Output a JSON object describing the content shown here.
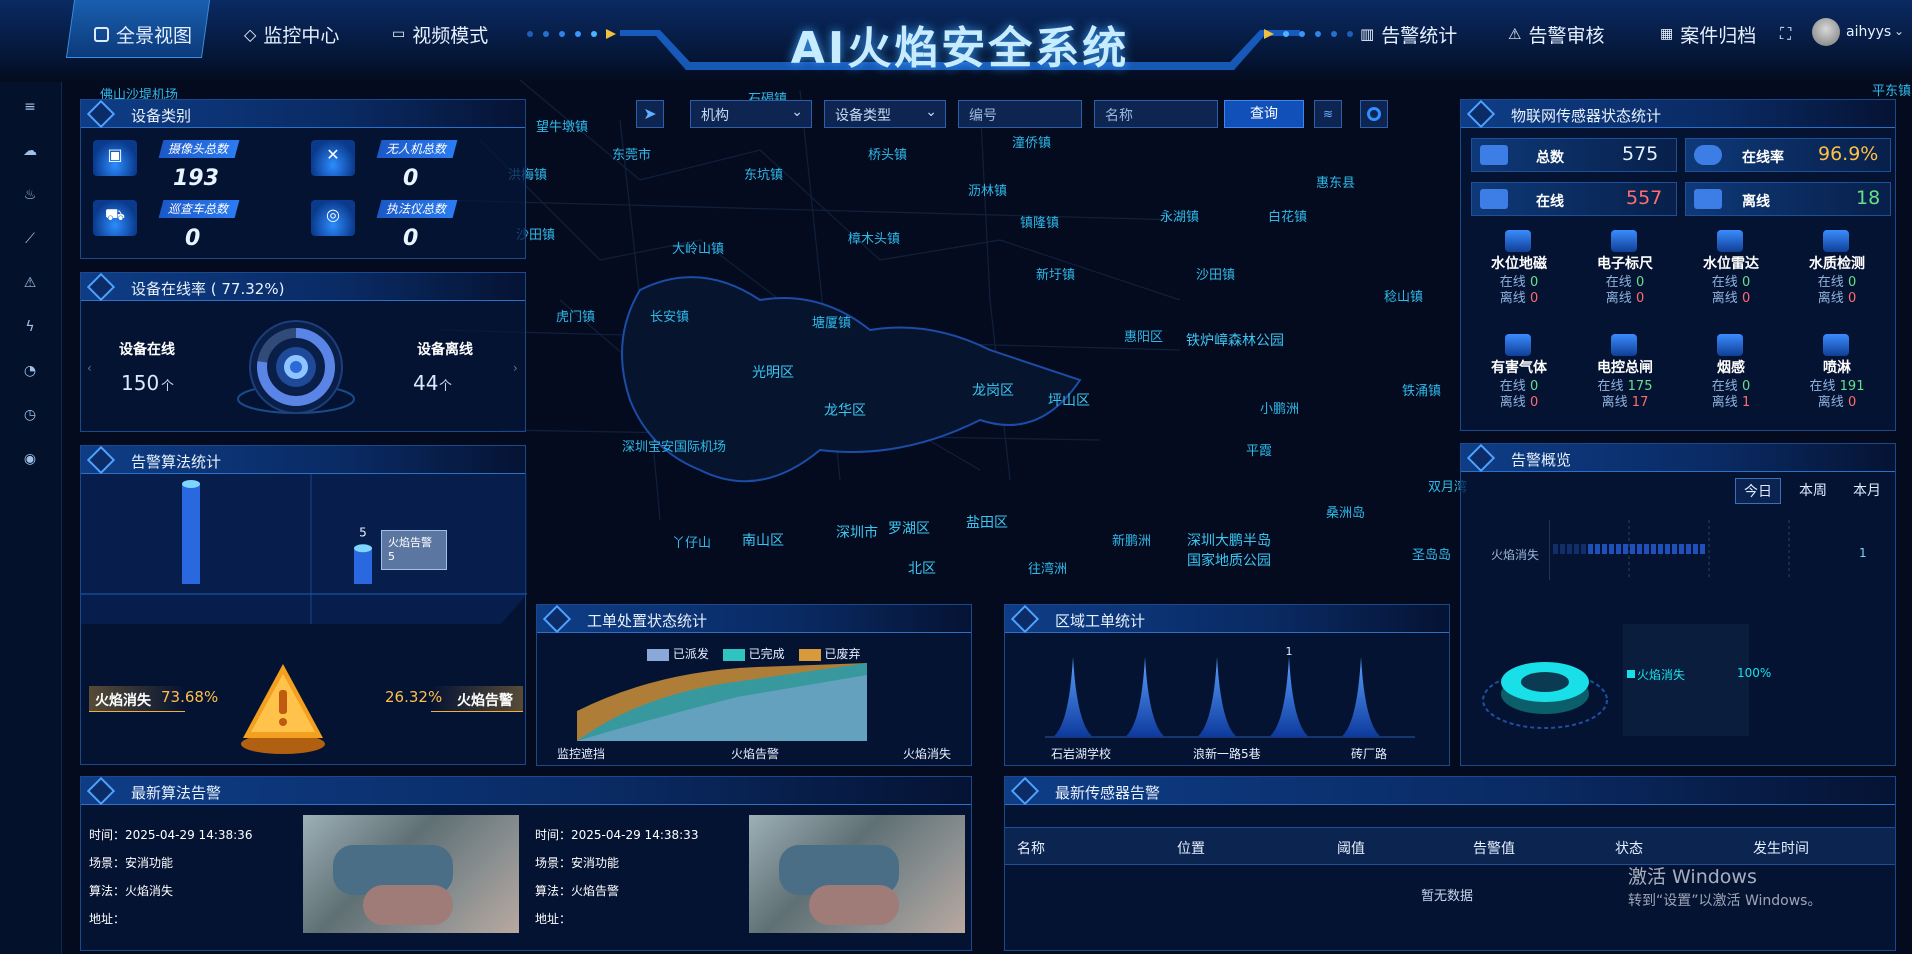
{
  "header": {
    "title": "AI火焰安全系统",
    "tabs_left": [
      "全景视图",
      "监控中心",
      "视频模式"
    ],
    "tabs_right": [
      "告警统计",
      "告警审核",
      "案件归档"
    ],
    "user": "aihyys"
  },
  "map_labels": [
    "佛山沙堤机场",
    "望牛墩镇",
    "东莞市",
    "桥头镇",
    "潼侨镇",
    "惠东县",
    "洪梅镇",
    "东坑镇",
    "沥林镇",
    "沙田镇",
    "樟木头镇",
    "镇隆镇",
    "永湖镇",
    "白花镇",
    "大岭山镇",
    "新圩镇",
    "沙田镇",
    "稔山镇",
    "虎门镇",
    "长安镇",
    "塘厦镇",
    "惠阳区",
    "铁炉嶂森林公园",
    "光明区",
    "龙岗区",
    "坪山区",
    "小鹏洲",
    "铁涌镇",
    "龙华区",
    "深圳宝安国际机场",
    "平霞",
    "桑洲岛",
    "双月湾",
    "南山区",
    "深圳市",
    "罗湖区",
    "盐田区",
    "新鹏洲",
    "深圳大鹏半岛国家地质公园",
    "圣岛岛",
    "丫仔山",
    "往湾洲",
    "北区",
    "石碣镇",
    "平东镇"
  ],
  "toolbar": {
    "org": "机构",
    "device_type": "设备类型",
    "number_placeholder": "编号",
    "name_placeholder": "名称",
    "query": "查询"
  },
  "device_category": {
    "title": "设备类别",
    "items": [
      {
        "label": "摄像头总数",
        "value": "193",
        "icon": "camera-icon"
      },
      {
        "label": "无人机总数",
        "value": "0",
        "icon": "drone-icon"
      },
      {
        "label": "巡查车总数",
        "value": "0",
        "icon": "car-icon"
      },
      {
        "label": "执法仪总数",
        "value": "0",
        "icon": "recorder-icon"
      }
    ]
  },
  "online_rate": {
    "title": "设备在线率 ( 77.32%)",
    "online_label": "设备在线",
    "online_value": "150",
    "offline_label": "设备离线",
    "offline_value": "44",
    "unit": "个",
    "rate": 77.32
  },
  "algo_stats": {
    "title": "告警算法统计",
    "bars": [
      {
        "name": "火焰消失",
        "value": 14
      },
      {
        "name": "火焰告警",
        "value": 5
      }
    ],
    "tooltip_name": "火焰告警",
    "tooltip_value": "5",
    "ratio_left_label": "火焰消失",
    "ratio_left_value": "73.68%",
    "ratio_right_label": "火焰告警",
    "ratio_right_value": "26.32%"
  },
  "workorder_status": {
    "title": "工单处置状态统计",
    "legend": [
      "已派发",
      "已完成",
      "已废弃"
    ],
    "x_labels": [
      "监控遮挡",
      "火焰告警",
      "火焰消失"
    ],
    "colors": [
      "#8aa8d8",
      "#2fc4c0",
      "#d89a3a"
    ]
  },
  "region_workorder": {
    "title": "区域工单统计",
    "peaks": [
      0,
      0,
      0,
      1,
      0
    ],
    "peak_label": "1",
    "x_labels": [
      "石岩湖学校",
      "浪新一路5巷",
      "砖厂路"
    ]
  },
  "iot_stats": {
    "title": "物联网传感器状态统计",
    "total_label": "总数",
    "total_value": "575",
    "rate_label": "在线率",
    "rate_value": "96.9%",
    "online_label": "在线",
    "online_value": "557",
    "offline_label": "离线",
    "offline_value": "18",
    "sensors": [
      {
        "name": "水位地磁",
        "online": "0",
        "offline": "0"
      },
      {
        "name": "电子标尺",
        "online": "0",
        "offline": "0"
      },
      {
        "name": "水位雷达",
        "online": "0",
        "offline": "0"
      },
      {
        "name": "水质检测",
        "online": "0",
        "offline": "0"
      },
      {
        "name": "有害气体",
        "online": "0",
        "offline": "0"
      },
      {
        "name": "电控总闸",
        "online": "175",
        "offline": "17"
      },
      {
        "name": "烟感",
        "online": "0",
        "offline": "1"
      },
      {
        "name": "喷淋",
        "online": "191",
        "offline": "0"
      }
    ],
    "online_prefix": "在线",
    "offline_prefix": "离线"
  },
  "alarm_overview": {
    "title": "告警概览",
    "ranges": [
      "今日",
      "本周",
      "本月"
    ],
    "row_label": "火焰消失",
    "row_value": "1",
    "legend_name": "火焰消失",
    "legend_pct": "100%"
  },
  "latest_algo": {
    "title": "最新算法告警",
    "items": [
      {
        "time": "时间：2025-04-29 14:38:36",
        "scene": "场景：安消功能",
        "algo": "算法：火焰消失",
        "addr": "地址："
      },
      {
        "time": "时间：2025-04-29 14:38:33",
        "scene": "场景：安消功能",
        "algo": "算法：火焰告警",
        "addr": "地址："
      }
    ]
  },
  "latest_sensor": {
    "title": "最新传感器告警",
    "columns": [
      "名称",
      "位置",
      "阈值",
      "告警值",
      "状态",
      "发生时间"
    ],
    "empty": "暂无数据"
  },
  "watermark": {
    "line1": "激活 Windows",
    "line2": "转到“设置”以激活 Windows。"
  }
}
